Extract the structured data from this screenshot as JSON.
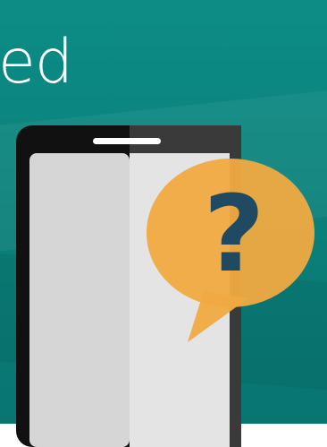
{
  "hero": {
    "heading": "ed",
    "background_color": "#0b7f79",
    "text_color": "#ffffff"
  },
  "illustration": {
    "phone_icon": "smartphone-icon",
    "bubble_icon": "speech-bubble-question-icon",
    "bubble_symbol": "?",
    "bubble_color": "#f0aa41",
    "symbol_color": "#1f4a62"
  }
}
